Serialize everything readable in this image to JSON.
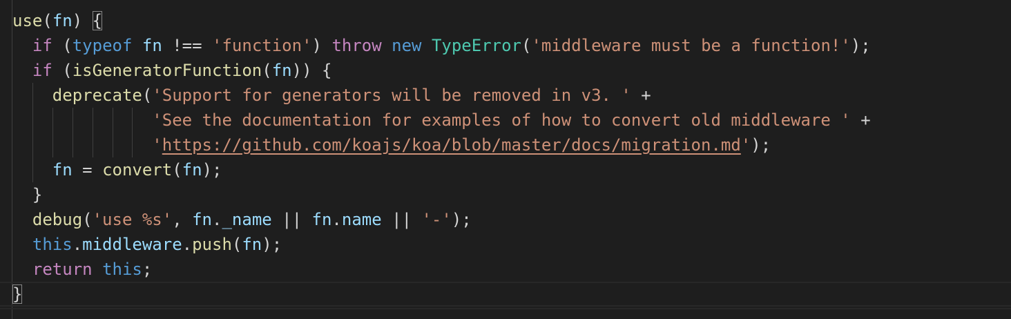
{
  "editor": {
    "language": "javascript",
    "colors": {
      "background": "#1e1e1e",
      "keyword": "#c586c0",
      "storage": "#569cd6",
      "function": "#dcdcaa",
      "variable": "#9cdcfe",
      "string": "#ce9178",
      "class": "#4ec9b0",
      "punctuation": "#d4d4d4"
    },
    "lines": [
      {
        "indent": 0,
        "tokens": [
          {
            "t": "use",
            "c": "fn"
          },
          {
            "t": "(",
            "c": "pun"
          },
          {
            "t": "fn",
            "c": "var"
          },
          {
            "t": ") ",
            "c": "pun"
          },
          {
            "t": "{",
            "c": "pun",
            "match": true
          }
        ]
      },
      {
        "indent": 1,
        "tokens": [
          {
            "t": "if",
            "c": "kw"
          },
          {
            "t": " (",
            "c": "pun"
          },
          {
            "t": "typeof",
            "c": "kw2"
          },
          {
            "t": " ",
            "c": "pun"
          },
          {
            "t": "fn",
            "c": "var"
          },
          {
            "t": " !== ",
            "c": "pun"
          },
          {
            "t": "'function'",
            "c": "str"
          },
          {
            "t": ") ",
            "c": "pun"
          },
          {
            "t": "throw",
            "c": "kw"
          },
          {
            "t": " ",
            "c": "pun"
          },
          {
            "t": "new",
            "c": "kw2"
          },
          {
            "t": " ",
            "c": "pun"
          },
          {
            "t": "TypeError",
            "c": "cls"
          },
          {
            "t": "(",
            "c": "pun"
          },
          {
            "t": "'middleware must be a function!'",
            "c": "str"
          },
          {
            "t": ");",
            "c": "pun"
          }
        ]
      },
      {
        "indent": 1,
        "tokens": [
          {
            "t": "if",
            "c": "kw"
          },
          {
            "t": " (",
            "c": "pun"
          },
          {
            "t": "isGeneratorFunction",
            "c": "fn"
          },
          {
            "t": "(",
            "c": "pun"
          },
          {
            "t": "fn",
            "c": "var"
          },
          {
            "t": ")) {",
            "c": "pun"
          }
        ]
      },
      {
        "indent": 2,
        "tokens": [
          {
            "t": "deprecate",
            "c": "fn"
          },
          {
            "t": "(",
            "c": "pun"
          },
          {
            "t": "'Support for generators will be removed in v3. '",
            "c": "str"
          },
          {
            "t": " +",
            "c": "pun"
          }
        ]
      },
      {
        "indent": 7,
        "tokens": [
          {
            "t": "'See the documentation for examples of how to convert old middleware '",
            "c": "str"
          },
          {
            "t": " +",
            "c": "pun"
          }
        ]
      },
      {
        "indent": 7,
        "tokens": [
          {
            "t": "'",
            "c": "str"
          },
          {
            "t": "https://github.com/koajs/koa/blob/master/docs/migration.md",
            "c": "link"
          },
          {
            "t": "'",
            "c": "str"
          },
          {
            "t": ");",
            "c": "pun"
          }
        ]
      },
      {
        "indent": 2,
        "tokens": [
          {
            "t": "fn",
            "c": "var"
          },
          {
            "t": " = ",
            "c": "pun"
          },
          {
            "t": "convert",
            "c": "fn"
          },
          {
            "t": "(",
            "c": "pun"
          },
          {
            "t": "fn",
            "c": "var"
          },
          {
            "t": ");",
            "c": "pun"
          }
        ]
      },
      {
        "indent": 1,
        "tokens": [
          {
            "t": "}",
            "c": "pun"
          }
        ]
      },
      {
        "indent": 1,
        "tokens": [
          {
            "t": "debug",
            "c": "fn"
          },
          {
            "t": "(",
            "c": "pun"
          },
          {
            "t": "'use %s'",
            "c": "str"
          },
          {
            "t": ", ",
            "c": "pun"
          },
          {
            "t": "fn",
            "c": "var"
          },
          {
            "t": ".",
            "c": "pun"
          },
          {
            "t": "_name",
            "c": "var"
          },
          {
            "t": " || ",
            "c": "pun"
          },
          {
            "t": "fn",
            "c": "var"
          },
          {
            "t": ".",
            "c": "pun"
          },
          {
            "t": "name",
            "c": "var"
          },
          {
            "t": " || ",
            "c": "pun"
          },
          {
            "t": "'-'",
            "c": "str"
          },
          {
            "t": ");",
            "c": "pun"
          }
        ]
      },
      {
        "indent": 1,
        "tokens": [
          {
            "t": "this",
            "c": "kw2"
          },
          {
            "t": ".",
            "c": "pun"
          },
          {
            "t": "middleware",
            "c": "var"
          },
          {
            "t": ".",
            "c": "pun"
          },
          {
            "t": "push",
            "c": "fn"
          },
          {
            "t": "(",
            "c": "pun"
          },
          {
            "t": "fn",
            "c": "var"
          },
          {
            "t": ");",
            "c": "pun"
          }
        ]
      },
      {
        "indent": 1,
        "tokens": [
          {
            "t": "return",
            "c": "kw"
          },
          {
            "t": " ",
            "c": "pun"
          },
          {
            "t": "this",
            "c": "kw2"
          },
          {
            "t": ";",
            "c": "pun"
          }
        ]
      },
      {
        "indent": 0,
        "current": true,
        "tokens": [
          {
            "t": "}",
            "c": "pun",
            "match": true
          }
        ]
      }
    ]
  }
}
